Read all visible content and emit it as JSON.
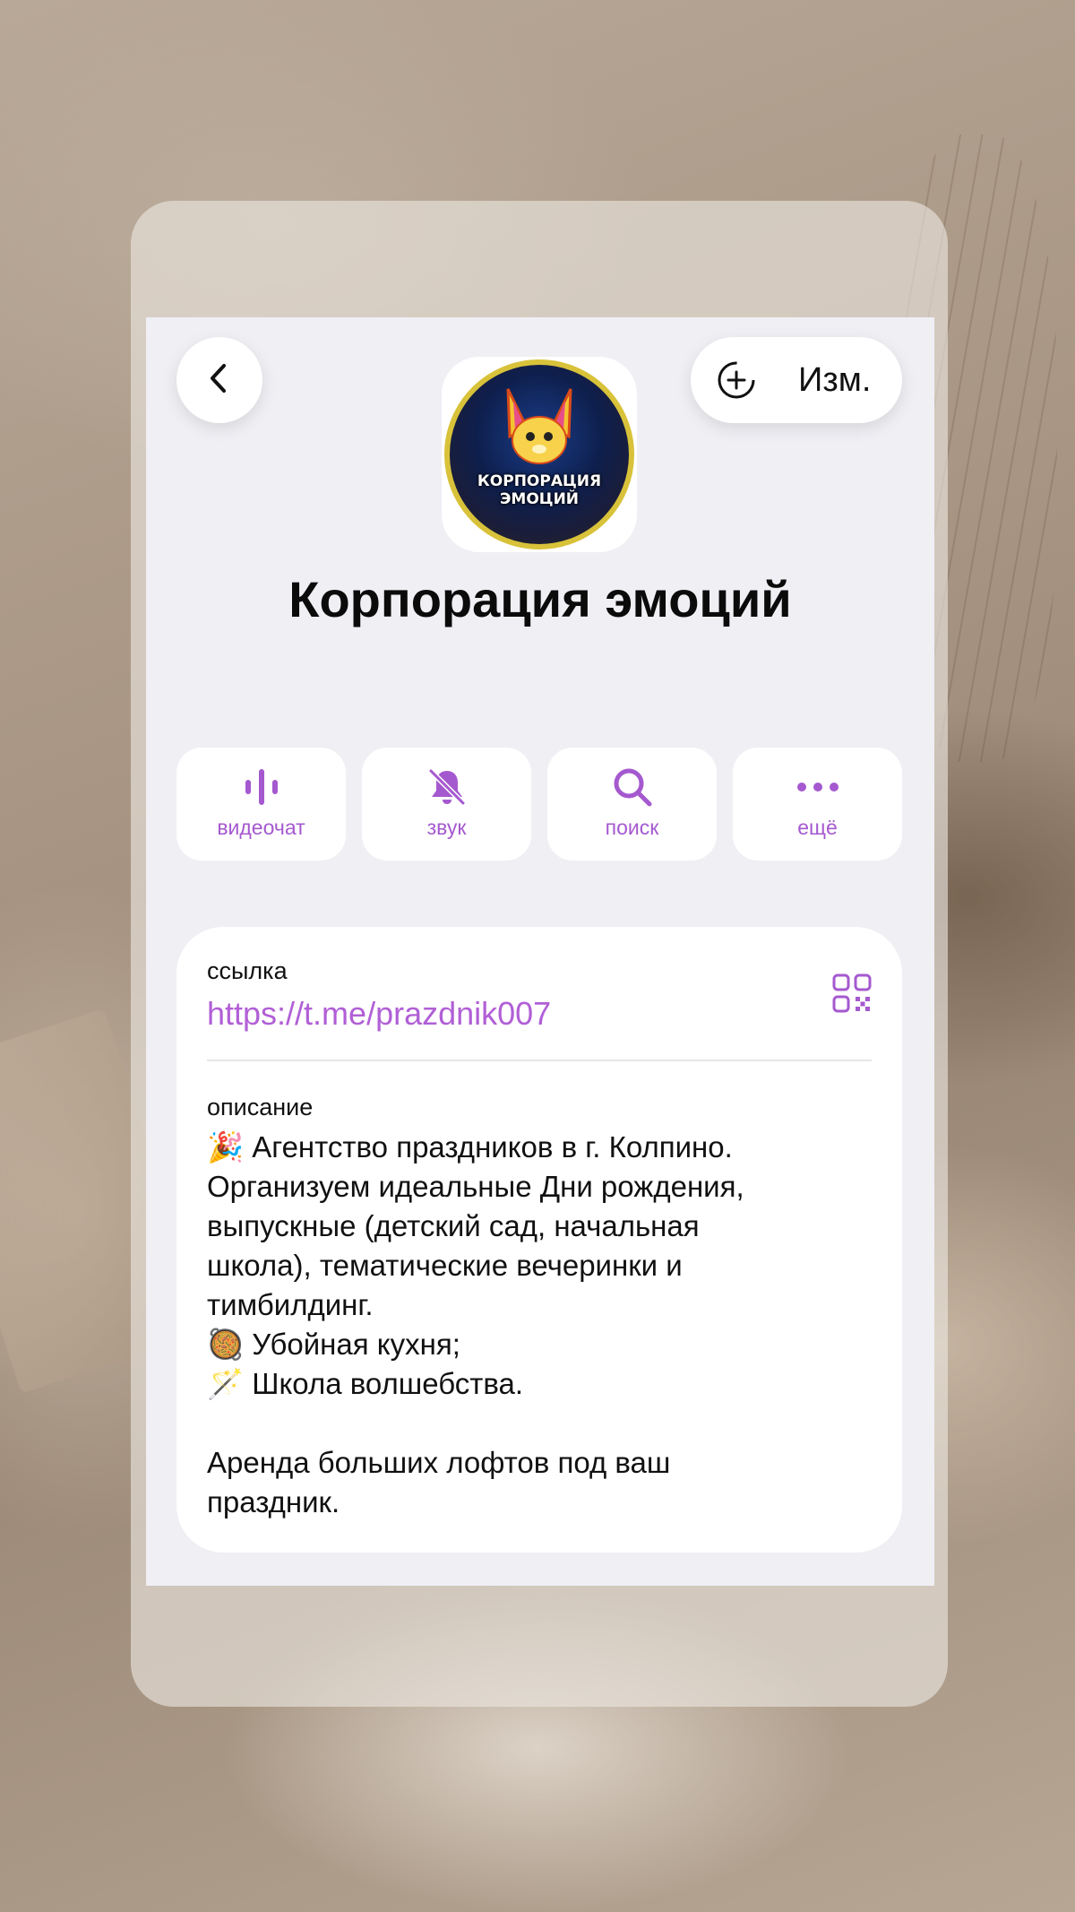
{
  "header": {
    "edit_label": "Изм.",
    "avatar_text": "КОРПОРАЦИЯ ЭМОЦИЙ"
  },
  "channel": {
    "title": "Корпорация эмоций"
  },
  "actions": [
    {
      "label": "видеочат",
      "icon": "voice-chat-icon"
    },
    {
      "label": "звук",
      "icon": "bell-muted-icon"
    },
    {
      "label": "поиск",
      "icon": "search-icon"
    },
    {
      "label": "ещё",
      "icon": "more-dots-icon"
    }
  ],
  "info": {
    "link_label": "ссылка",
    "link": "https://t.me/prazdnik007",
    "description_label": "описание",
    "description_lines": [
      "🎉 Агентство праздников в г. Колпино.",
      "Организуем идеальные Дни рождения,",
      "выпускные (детский сад, начальная",
      "школа), тематические вечеринки и",
      "тимбилдинг.",
      "🥘 Убойная кухня;",
      "🪄 Школа волшебства.",
      "",
      "Аренда больших лофтов под ваш",
      "праздник."
    ]
  },
  "colors": {
    "accent": "#a559cf",
    "screen_bg": "#efeff4",
    "card_bg": "#ffffff"
  }
}
